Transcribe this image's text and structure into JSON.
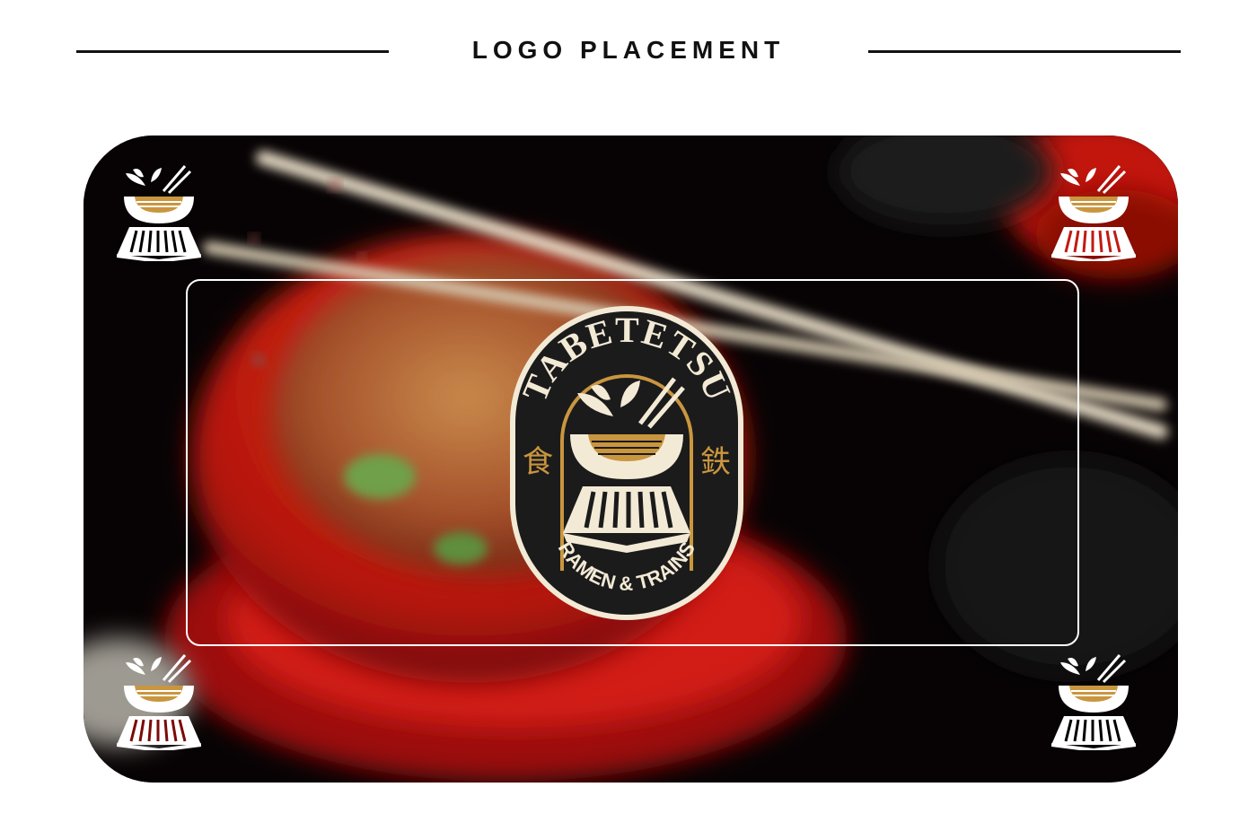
{
  "page": {
    "title": "LOGO PLACEMENT"
  },
  "logo": {
    "brand_name": "TABETETSU",
    "tagline": "RAMEN & TRAINS",
    "kanji_left": "食",
    "kanji_right": "鉄"
  },
  "colors": {
    "gold": "#c9963f",
    "badge_dark": "#1b1b1b",
    "ink": "#111111",
    "accent_red": "#e01a14"
  },
  "icons": {
    "corner_mark": "ramen-train-icon"
  }
}
